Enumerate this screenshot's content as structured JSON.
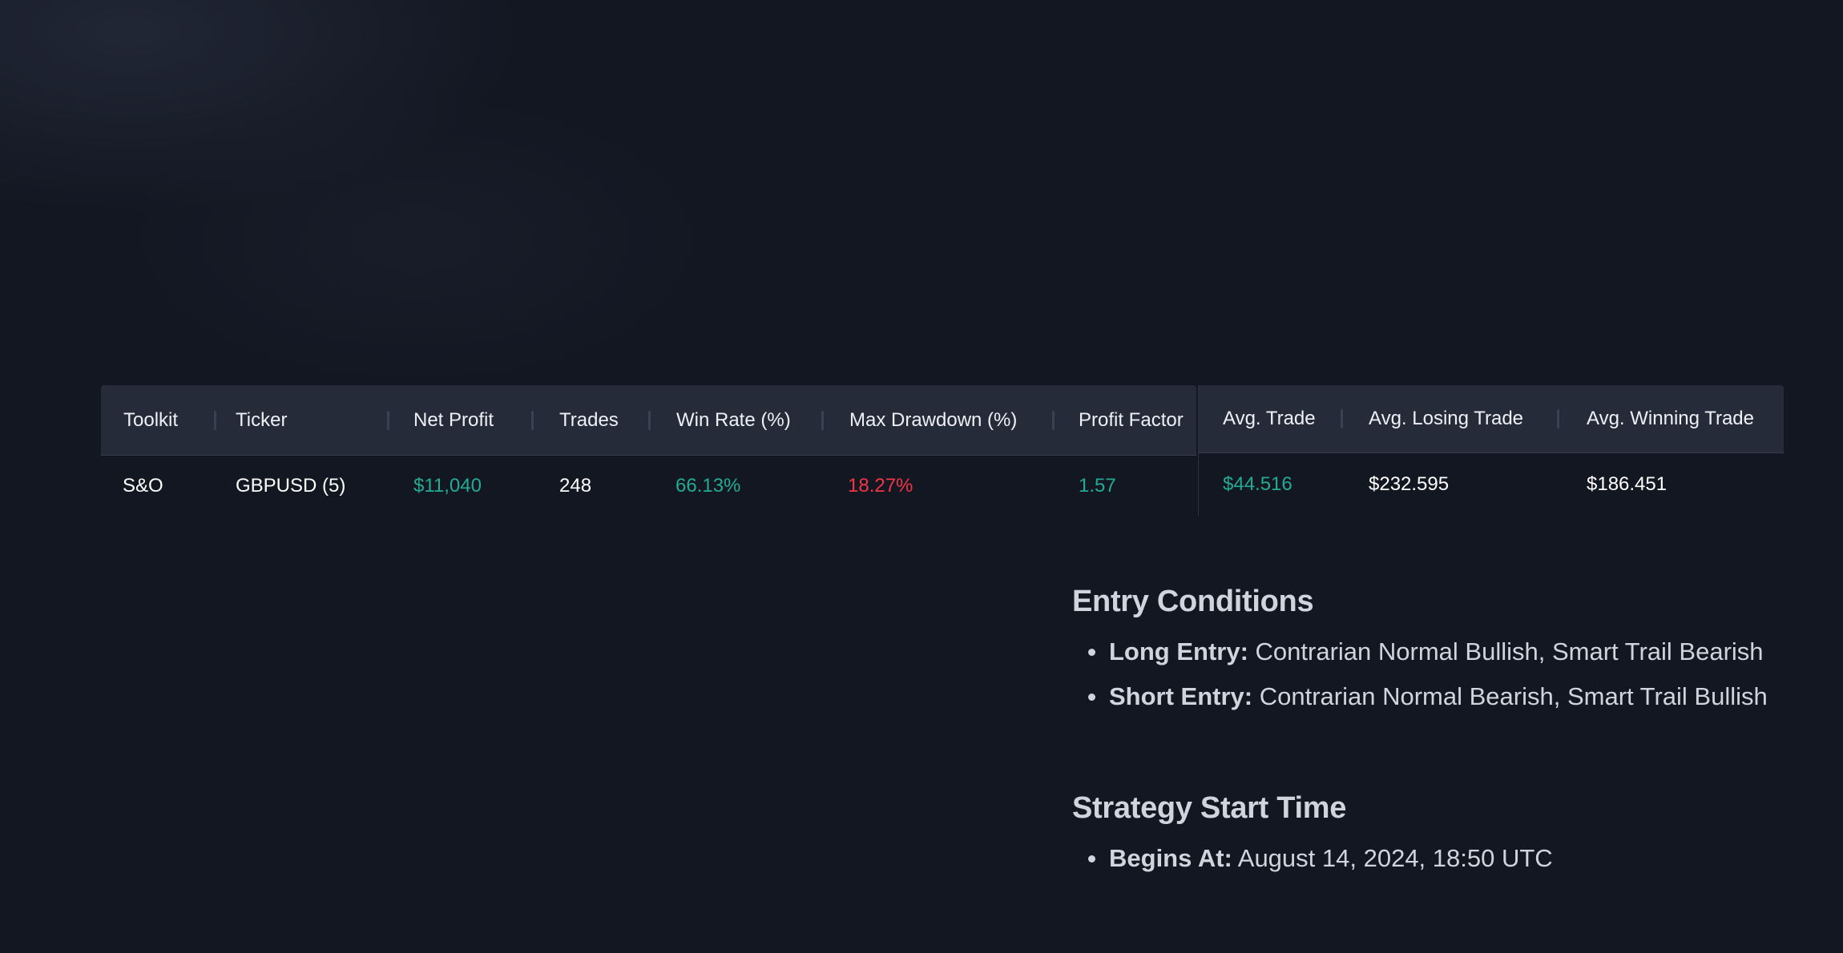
{
  "colors": {
    "background": "#131722",
    "header_bg": "#262b3a",
    "positive": "#22ab94",
    "negative": "#f23645",
    "text": "#d1d4dc"
  },
  "stats_table": {
    "headers": {
      "toolkit": "Toolkit",
      "ticker": "Ticker",
      "net_profit": "Net Profit",
      "trades": "Trades",
      "win_rate": "Win Rate (%)",
      "max_drawdown": "Max Drawdown (%)",
      "profit_factor": "Profit Factor",
      "avg_trade": "Avg. Trade",
      "avg_losing_trade": "Avg. Losing Trade",
      "avg_winning_trade": "Avg. Winning Trade"
    },
    "row": {
      "toolkit": "S&O",
      "ticker": "GBPUSD (5)",
      "net_profit": "$11,040",
      "trades": "248",
      "win_rate": "66.13%",
      "max_drawdown": "18.27%",
      "profit_factor": "1.57",
      "avg_trade": "$44.516",
      "avg_losing_trade": "$232.595",
      "avg_winning_trade": "$186.451"
    }
  },
  "entry_conditions": {
    "title": "Entry Conditions",
    "items": [
      {
        "label": "Long Entry:",
        "text": "Contrarian Normal Bullish, Smart Trail Bearish"
      },
      {
        "label": "Short Entry:",
        "text": "Contrarian Normal Bearish, Smart Trail Bullish"
      }
    ]
  },
  "strategy_start": {
    "title": "Strategy Start Time",
    "items": [
      {
        "label": "Begins At:",
        "text": "August 14, 2024, 18:50 UTC"
      }
    ]
  }
}
